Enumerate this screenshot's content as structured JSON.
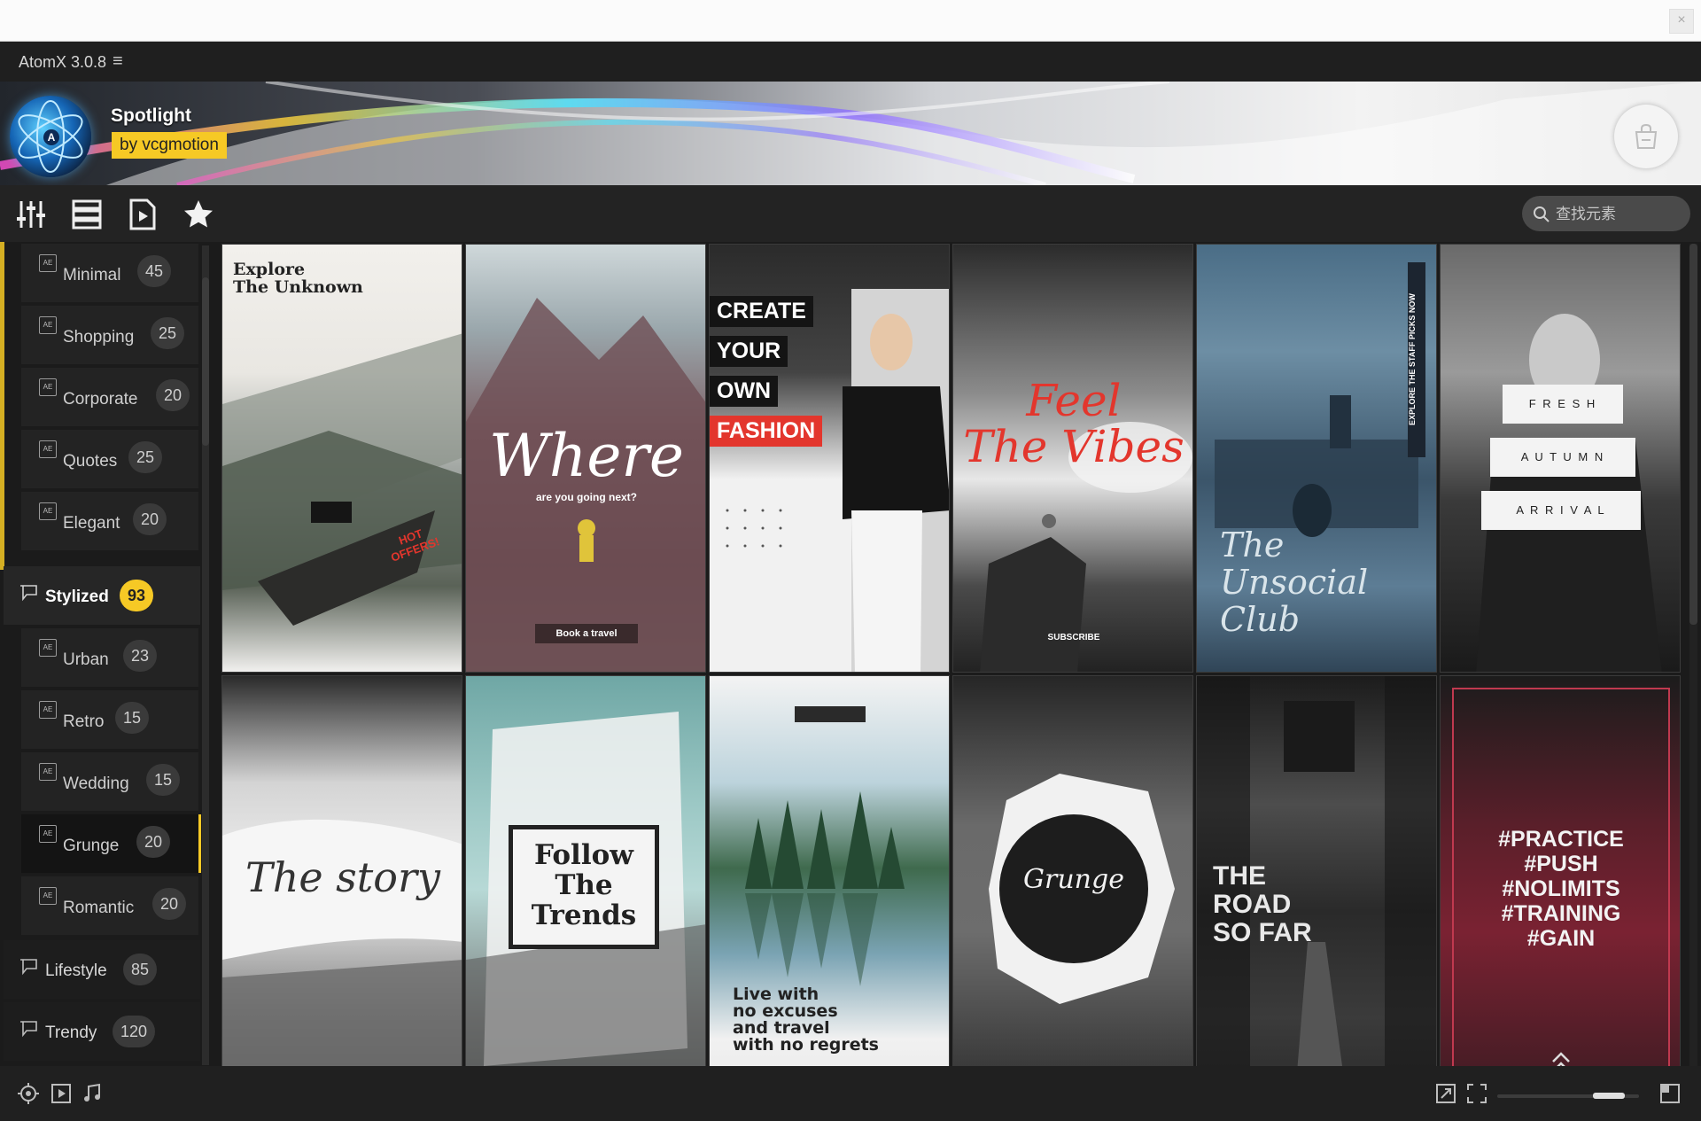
{
  "app": {
    "title": "AtomX 3.0.8",
    "menu_glyph": "≡"
  },
  "os": {
    "close_glyph": "×"
  },
  "banner": {
    "title": "Spotlight",
    "by": "by vcgmotion",
    "logo_letter": "A"
  },
  "search": {
    "placeholder": "查找元素"
  },
  "sidebar": {
    "items": [
      {
        "label": "Minimal",
        "count": "45"
      },
      {
        "label": "Shopping",
        "count": "25"
      },
      {
        "label": "Corporate",
        "count": "20"
      },
      {
        "label": "Quotes",
        "count": "25"
      },
      {
        "label": "Elegant",
        "count": "20"
      },
      {
        "label": "Stylized",
        "count": "93"
      },
      {
        "label": "Urban",
        "count": "23"
      },
      {
        "label": "Retro",
        "count": "15"
      },
      {
        "label": "Wedding",
        "count": "15"
      },
      {
        "label": "Grunge",
        "count": "20"
      },
      {
        "label": "Romantic",
        "count": "20"
      },
      {
        "label": "Lifestyle",
        "count": "85"
      },
      {
        "label": "Trendy",
        "count": "120"
      }
    ],
    "ae_icon_text": "AE"
  },
  "cards": [
    {
      "line1": "Explore",
      "line2": "The Unknown",
      "tag": "HOT OFFERS!"
    },
    {
      "script": "Where",
      "sub": "are you going next?",
      "btn": "Book a travel"
    },
    {
      "l1": "CREATE",
      "l2": "YOUR",
      "l3": "OWN",
      "l4": "FASHION"
    },
    {
      "l1": "Feel",
      "l2": "The Vibes",
      "btn": "SUBSCRIBE"
    },
    {
      "side": "EXPLORE THE STAFF PICKS NOW",
      "l1": "The",
      "l2": "Unsocial",
      "l3": "Club"
    },
    {
      "l1": "F R E S H",
      "l2": "A U T U M N",
      "l3": "A R R I V A L"
    },
    {
      "script": "The story"
    },
    {
      "l1": "Follow",
      "l2": "The",
      "l3": "Trends"
    },
    {
      "l1": "Live with",
      "l2": "no excuses",
      "l3": "and travel",
      "l4": "with no regrets"
    },
    {
      "script": "Grunge"
    },
    {
      "l1": "THE",
      "l2": "ROAD",
      "l3": "SO FAR"
    },
    {
      "l1": "#PRACTICE",
      "l2": "#PUSH",
      "l3": "#NOLIMITS",
      "l4": "#TRAINING",
      "l5": "#GAIN"
    }
  ],
  "colors": {
    "accent": "#f6c925",
    "red": "#e3362d",
    "bg": "#1b1b1b"
  }
}
